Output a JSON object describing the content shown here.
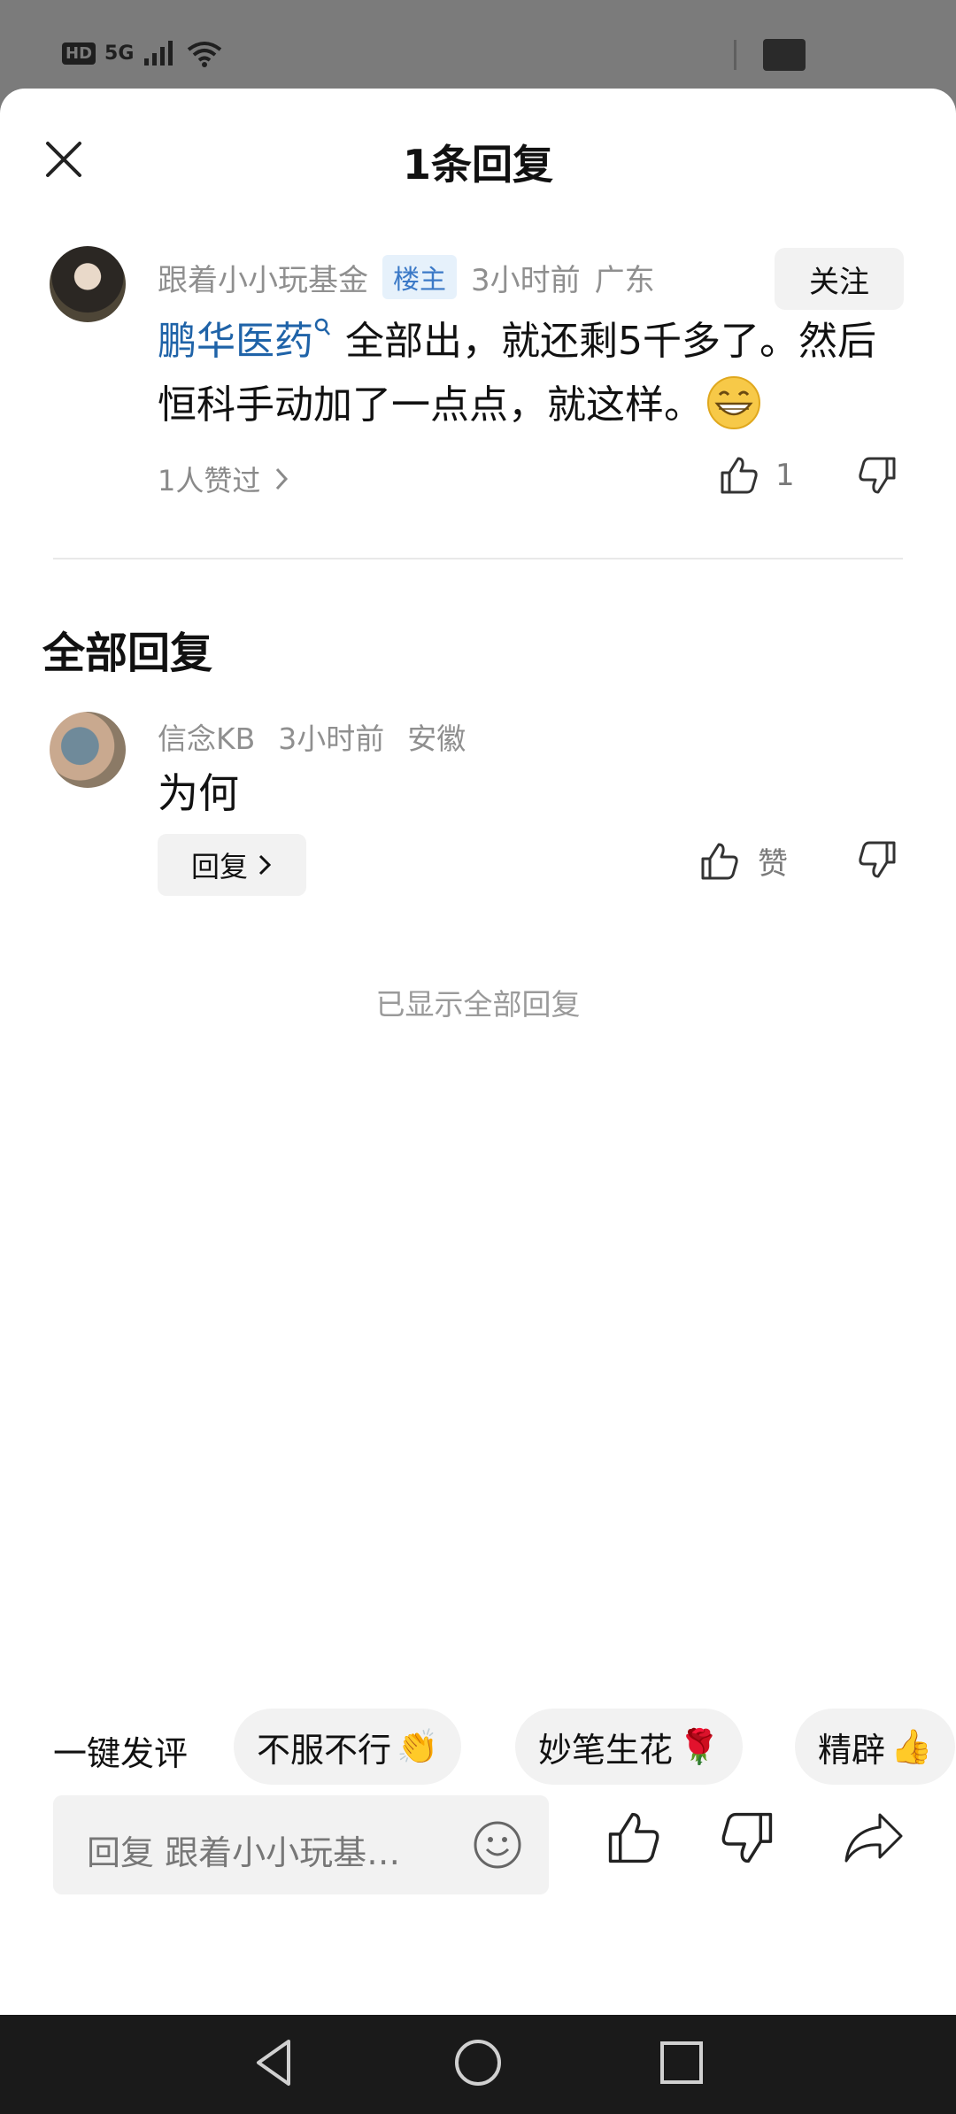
{
  "status_bar": {
    "hd_label": "HD",
    "network": "5G"
  },
  "sheet": {
    "title": "1条回复"
  },
  "op_comment": {
    "username": "跟着小小玩基金",
    "badge": "楼主",
    "time": "3小时前",
    "location": "广东",
    "follow_label": "关注",
    "stock_link": "鹏华医药",
    "text_part1": "全部出，就还剩5千多了。然后恒科手动加了一点点，就这样。",
    "emoji": "grinning-face",
    "likers_text": "1人赞过",
    "like_count": "1"
  },
  "section_title": "全部回复",
  "replies": [
    {
      "username": "信念KB",
      "time": "3小时前",
      "location": "安徽",
      "text": "为何",
      "reply_label": "回复",
      "like_label": "赞"
    }
  ],
  "all_shown_text": "已显示全部回复",
  "quick_comment": {
    "label": "一键发评",
    "chips": [
      {
        "text": "不服不行",
        "emoji": "👏"
      },
      {
        "text": "妙笔生花",
        "emoji": "🌹"
      },
      {
        "text": "精辟",
        "emoji": "👍"
      }
    ]
  },
  "input": {
    "placeholder": "回复 跟着小小玩基…"
  },
  "colors": {
    "link": "#1f63a8",
    "badge_bg": "#e6f1fb",
    "badge_text": "#3b79c7",
    "chip_bg": "#f2f2f2",
    "muted": "#8f8f8f"
  }
}
